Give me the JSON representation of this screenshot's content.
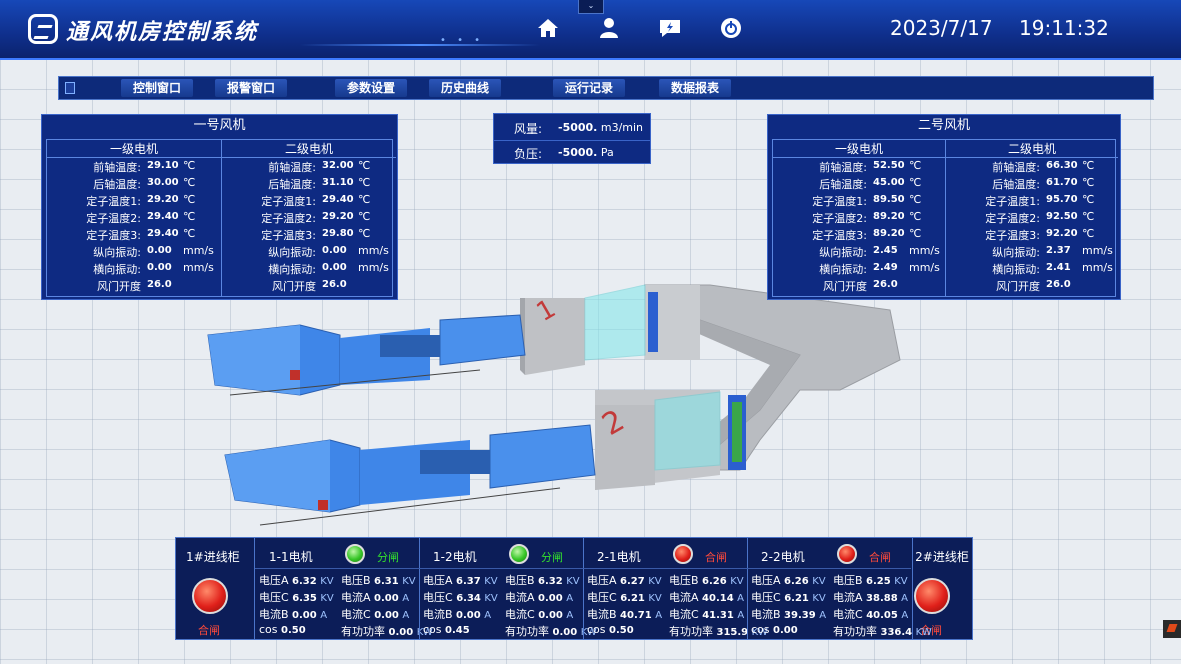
{
  "header": {
    "title": "通风机房控制系统",
    "date": "2023/7/17",
    "time": "19:11:32",
    "icons": [
      "home-icon",
      "user-icon",
      "message-icon",
      "power-icon"
    ],
    "collapse": "⌄"
  },
  "menu": {
    "items": [
      "控制窗口",
      "报警窗口",
      "参数设置",
      "历史曲线",
      "运行记录",
      "数据报表"
    ]
  },
  "fan1": {
    "title": "一号风机",
    "motor1": {
      "head": "一级电机",
      "rows": [
        {
          "label": "前轴温度:",
          "value": "29.10",
          "unit": "℃"
        },
        {
          "label": "后轴温度:",
          "value": "30.00",
          "unit": "℃"
        },
        {
          "label": "定子温度1:",
          "value": "29.20",
          "unit": "℃"
        },
        {
          "label": "定子温度2:",
          "value": "29.40",
          "unit": "℃"
        },
        {
          "label": "定子温度3:",
          "value": "29.40",
          "unit": "℃"
        },
        {
          "label": "纵向振动:",
          "value": "0.00",
          "unit": "mm/s"
        },
        {
          "label": "横向振动:",
          "value": "0.00",
          "unit": "mm/s"
        },
        {
          "label": "风门开度",
          "value": "26.0",
          "unit": ""
        }
      ]
    },
    "motor2": {
      "head": "二级电机",
      "rows": [
        {
          "label": "前轴温度:",
          "value": "32.00",
          "unit": "℃"
        },
        {
          "label": "后轴温度:",
          "value": "31.10",
          "unit": "℃"
        },
        {
          "label": "定子温度1:",
          "value": "29.40",
          "unit": "℃"
        },
        {
          "label": "定子温度2:",
          "value": "29.20",
          "unit": "℃"
        },
        {
          "label": "定子温度3:",
          "value": "29.80",
          "unit": "℃"
        },
        {
          "label": "纵向振动:",
          "value": "0.00",
          "unit": "mm/s"
        },
        {
          "label": "横向振动:",
          "value": "0.00",
          "unit": "mm/s"
        },
        {
          "label": "风门开度",
          "value": "26.0",
          "unit": ""
        }
      ]
    }
  },
  "fan2": {
    "title": "二号风机",
    "motor1": {
      "head": "一级电机",
      "rows": [
        {
          "label": "前轴温度:",
          "value": "52.50",
          "unit": "℃"
        },
        {
          "label": "后轴温度:",
          "value": "45.00",
          "unit": "℃"
        },
        {
          "label": "定子温度1:",
          "value": "89.50",
          "unit": "℃"
        },
        {
          "label": "定子温度2:",
          "value": "89.20",
          "unit": "℃"
        },
        {
          "label": "定子温度3:",
          "value": "89.20",
          "unit": "℃"
        },
        {
          "label": "纵向振动:",
          "value": "2.45",
          "unit": "mm/s"
        },
        {
          "label": "横向振动:",
          "value": "2.49",
          "unit": "mm/s"
        },
        {
          "label": "风门开度",
          "value": "26.0",
          "unit": ""
        }
      ]
    },
    "motor2": {
      "head": "二级电机",
      "rows": [
        {
          "label": "前轴温度:",
          "value": "66.30",
          "unit": "℃"
        },
        {
          "label": "后轴温度:",
          "value": "61.70",
          "unit": "℃"
        },
        {
          "label": "定子温度1:",
          "value": "95.70",
          "unit": "℃"
        },
        {
          "label": "定子温度2:",
          "value": "92.50",
          "unit": "℃"
        },
        {
          "label": "定子温度3:",
          "value": "92.20",
          "unit": "℃"
        },
        {
          "label": "纵向振动:",
          "value": "2.37",
          "unit": "mm/s"
        },
        {
          "label": "横向振动:",
          "value": "2.41",
          "unit": "mm/s"
        },
        {
          "label": "风门开度",
          "value": "26.0",
          "unit": ""
        }
      ]
    }
  },
  "airflow": {
    "volume_label": "风量:",
    "volume_value": "-5000.",
    "volume_unit": "m3/min",
    "pressure_label": "负压:",
    "pressure_value": "-5000.",
    "pressure_unit": "Pa"
  },
  "scene": {
    "duct1_number": "1",
    "duct2_number": "2",
    "colors": {
      "fan_blue": "#3f86e8",
      "concrete": "#b9bcc1",
      "glass": "#7fe6ea"
    }
  },
  "bottom": {
    "cabinet1": {
      "label": "1#进线柜",
      "state": "合闸"
    },
    "cabinet2": {
      "label": "2#进线柜",
      "state": "合闸"
    },
    "motors": [
      {
        "name": "1-1电机",
        "state": "分闸",
        "lamp": "green",
        "cells": [
          [
            "电压A",
            "6.32",
            "KV"
          ],
          [
            "电压B",
            "6.31",
            "KV"
          ],
          [
            "电压C",
            "6.35",
            "KV"
          ],
          [
            "电流A",
            "0.00",
            "A"
          ],
          [
            "电流B",
            "0.00",
            "A"
          ],
          [
            "电流C",
            "0.00",
            "A"
          ],
          [
            "cos",
            "0.50",
            ""
          ],
          [
            "有功功率",
            "0.00",
            "KW"
          ]
        ]
      },
      {
        "name": "1-2电机",
        "state": "分闸",
        "lamp": "green",
        "cells": [
          [
            "电压A",
            "6.37",
            "KV"
          ],
          [
            "电压B",
            "6.32",
            "KV"
          ],
          [
            "电压C",
            "6.34",
            "KV"
          ],
          [
            "电流A",
            "0.00",
            "A"
          ],
          [
            "电流B",
            "0.00",
            "A"
          ],
          [
            "电流C",
            "0.00",
            "A"
          ],
          [
            "cos",
            "0.45",
            ""
          ],
          [
            "有功功率",
            "0.00",
            "KW"
          ]
        ]
      },
      {
        "name": "2-1电机",
        "state": "合闸",
        "lamp": "red",
        "cells": [
          [
            "电压A",
            "6.27",
            "KV"
          ],
          [
            "电压B",
            "6.26",
            "KV"
          ],
          [
            "电压C",
            "6.21",
            "KV"
          ],
          [
            "电流A",
            "40.14",
            "A"
          ],
          [
            "电流B",
            "40.71",
            "A"
          ],
          [
            "电流C",
            "41.31",
            "A"
          ],
          [
            "cos",
            "0.50",
            ""
          ],
          [
            "有功功率",
            "315.9",
            "KW"
          ]
        ]
      },
      {
        "name": "2-2电机",
        "state": "合闸",
        "lamp": "red",
        "cells": [
          [
            "电压A",
            "6.26",
            "KV"
          ],
          [
            "电压B",
            "6.25",
            "KV"
          ],
          [
            "电压C",
            "6.21",
            "KV"
          ],
          [
            "电流A",
            "38.88",
            "A"
          ],
          [
            "电流B",
            "39.39",
            "A"
          ],
          [
            "电流C",
            "40.05",
            "A"
          ],
          [
            "cos",
            "0.00",
            ""
          ],
          [
            "有功功率",
            "336.4",
            "KW"
          ]
        ]
      }
    ]
  }
}
